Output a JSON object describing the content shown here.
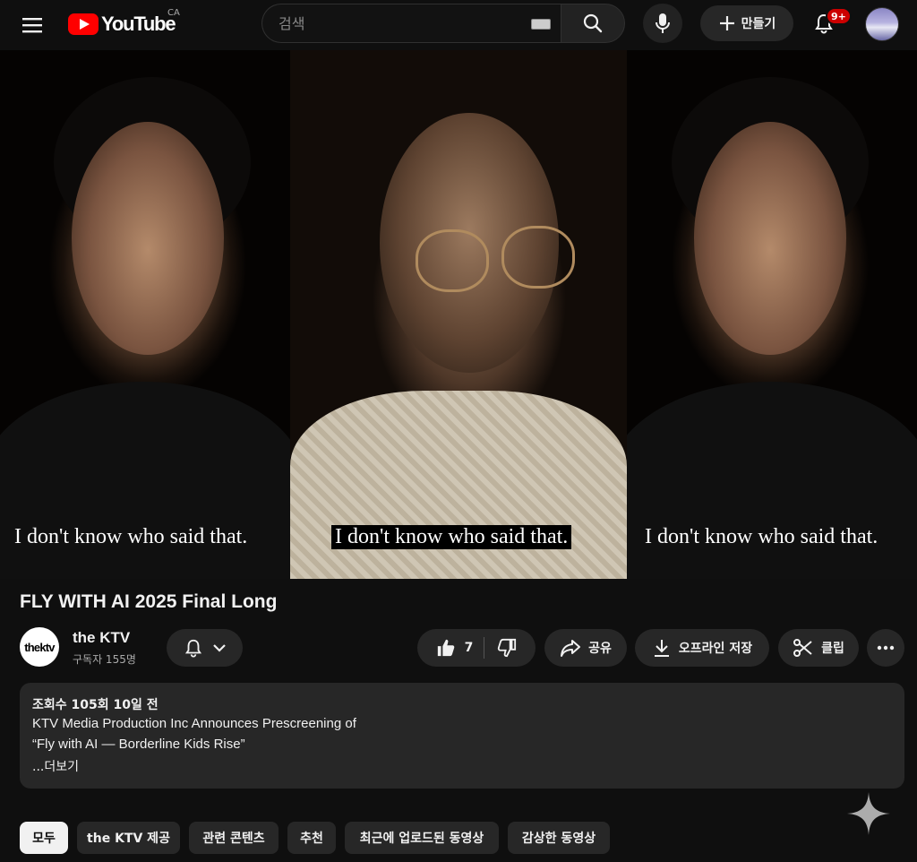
{
  "header": {
    "logo_text": "YouTube",
    "country": "CA",
    "search_placeholder": "검색",
    "create_label": "만들기",
    "notification_count": "9+"
  },
  "video": {
    "subtitle_left": "I don't know who said that.",
    "subtitle_mid": "I don't know who said that.",
    "subtitle_right": "I don't know who said that.",
    "title": "FLY WITH AI 2025 Final Long"
  },
  "channel": {
    "avatar_text": "thektv",
    "name": "the KTV",
    "subscribers": "구독자 155명"
  },
  "actions": {
    "likes": "7",
    "share": "공유",
    "download": "오프라인 저장",
    "clip": "클립"
  },
  "description": {
    "meta": "조회수 105회  10일 전",
    "line1": "KTV Media Production Inc Announces Prescreening of",
    "line2": "“Fly with AI — Borderline Kids Rise”",
    "more": "...더보기"
  },
  "chips": [
    {
      "label": "모두",
      "active": true
    },
    {
      "label": "the KTV 제공",
      "active": false
    },
    {
      "label": "관련 콘텐츠",
      "active": false
    },
    {
      "label": "추천",
      "active": false
    },
    {
      "label": "최근에 업로드된 동영상",
      "active": false
    },
    {
      "label": "감상한 동영상",
      "active": false
    }
  ]
}
